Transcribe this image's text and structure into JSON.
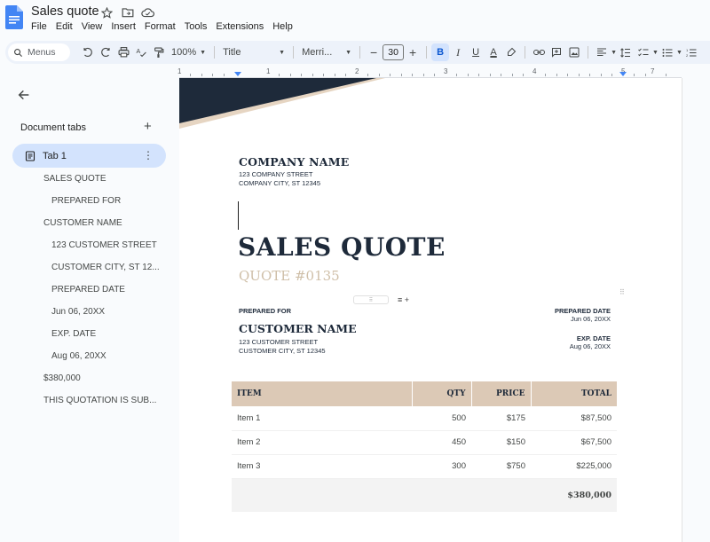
{
  "app": {
    "doc_title": "Sales quote",
    "menu": [
      "File",
      "Edit",
      "View",
      "Insert",
      "Format",
      "Tools",
      "Extensions",
      "Help"
    ]
  },
  "toolbar": {
    "search_placeholder": "Menus",
    "zoom": "100%",
    "style": "Title",
    "font": "Merri...",
    "font_size": "30",
    "bold": "B",
    "italic": "I",
    "underline": "U",
    "text_color": "A"
  },
  "ruler": {
    "labels": [
      "1",
      "1",
      "2",
      "3",
      "4",
      "5",
      "6",
      "7"
    ]
  },
  "sidebar": {
    "heading": "Document tabs",
    "tab_label": "Tab 1",
    "outline": [
      "SALES QUOTE",
      "PREPARED FOR",
      "CUSTOMER NAME",
      "123 CUSTOMER STREET",
      "CUSTOMER CITY, ST 12...",
      "PREPARED DATE",
      "Jun 06, 20XX",
      "EXP. DATE",
      "Aug 06, 20XX",
      "$380,000",
      "THIS QUOTATION IS SUB..."
    ]
  },
  "document": {
    "company_name": "COMPANY NAME",
    "company_street": "123 COMPANY STREET",
    "company_city": "COMPANY CITY, ST 12345",
    "title": "SALES QUOTE",
    "quote_number": "QUOTE #0135",
    "prepared_for_label": "PREPARED FOR",
    "customer_name": "CUSTOMER NAME",
    "customer_street": "123 CUSTOMER STREET",
    "customer_city": "CUSTOMER CITY, ST 12345",
    "prepared_date_label": "PREPARED DATE",
    "prepared_date": "Jun 06, 20XX",
    "exp_date_label": "EXP. DATE",
    "exp_date": "Aug 06, 20XX",
    "table": {
      "headers": [
        "ITEM",
        "QTY",
        "PRICE",
        "TOTAL"
      ],
      "rows": [
        [
          "Item 1",
          "500",
          "$175",
          "$87,500"
        ],
        [
          "Item 2",
          "450",
          "$150",
          "$67,500"
        ],
        [
          "Item 3",
          "300",
          "$750",
          "$225,000"
        ]
      ],
      "grand_total": "$380,000"
    }
  },
  "colors": {
    "navy": "#1e2a3a",
    "tan": "#dcc9b6",
    "quote_tan": "#cfbfa8",
    "accent_blue": "#0b57d0",
    "chip_blue": "#d3e3fd"
  }
}
